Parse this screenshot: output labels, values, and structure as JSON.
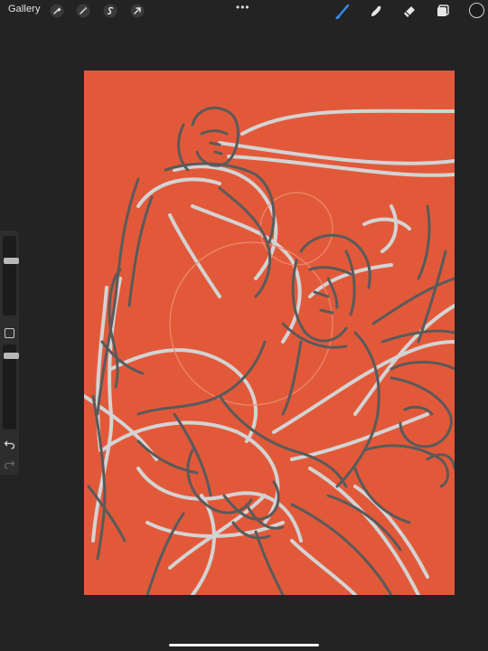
{
  "topbar": {
    "gallery_label": "Gallery",
    "left_tools": [
      "wrench-icon",
      "magic-wand-icon",
      "selection-s-icon",
      "transform-arrow-icon"
    ],
    "more_dots": "•••",
    "right_tools": [
      "brush-icon",
      "smudge-icon",
      "eraser-icon",
      "layers-icon"
    ],
    "active_tool": "brush-icon",
    "active_color": "#2f8cf0",
    "current_color": "#1c1c1c"
  },
  "canvas": {
    "background_color": "#e2593a",
    "sketch_colors": {
      "light_lines": "#d3d3d3",
      "dark_lines": "#5a5a5a"
    }
  },
  "sidebar": {
    "brush_size_level": 0.7,
    "opacity_level": 0.9,
    "undo_icon": "undo-icon",
    "redo_icon": "redo-icon"
  }
}
